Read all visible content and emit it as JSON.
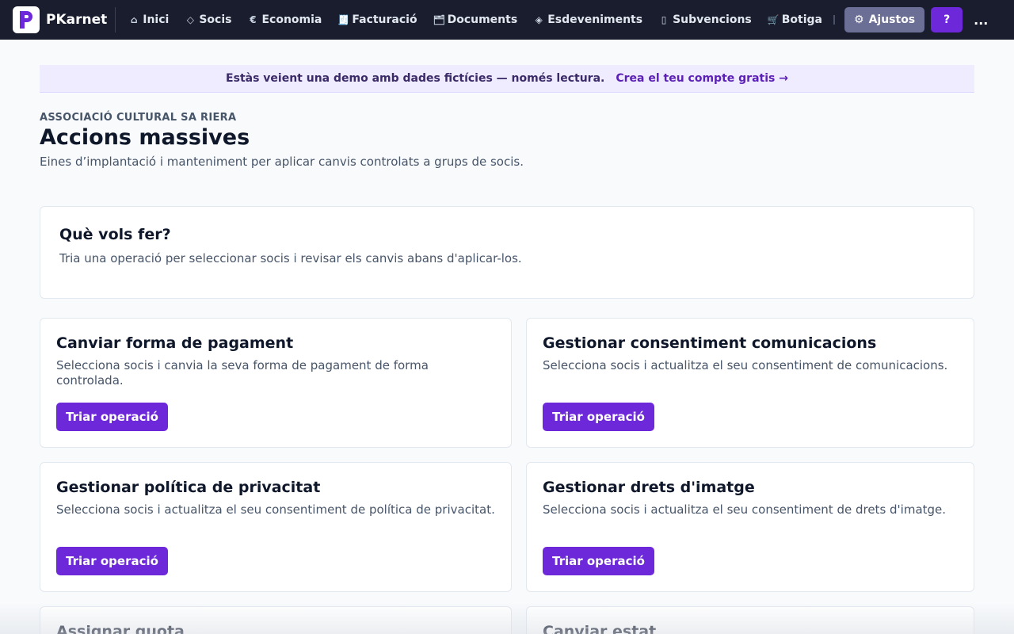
{
  "app": {
    "name": "PKarnet",
    "logo_letter": "P",
    "logo_color": "#6d28d9"
  },
  "nav": {
    "items": [
      {
        "label": "Inici",
        "icon": "home-icon",
        "glyph": "⌂"
      },
      {
        "label": "Socis",
        "icon": "diamond-icon",
        "glyph": "◇"
      },
      {
        "label": "Economia",
        "icon": "euro-icon",
        "glyph": "€"
      },
      {
        "label": "Facturació",
        "icon": "receipt-icon",
        "glyph": "🧾"
      },
      {
        "label": "Documents",
        "icon": "folder-icon",
        "glyph": "🗂"
      },
      {
        "label": "Esdeveniments",
        "icon": "diamond-dot-icon",
        "glyph": "◈"
      },
      {
        "label": "Subvencions",
        "icon": "columns-icon",
        "glyph": "▯"
      },
      {
        "label": "Botiga",
        "icon": "cart-icon",
        "glyph": "🛒"
      }
    ],
    "settings_label": "Ajustos",
    "settings_glyph": "⚙",
    "help_label": "?",
    "more_label": "..."
  },
  "banner": {
    "text": "Estàs veient una demo amb dades fictícies — només lectura.",
    "link": "Crea el teu compte gratis →"
  },
  "header": {
    "org": "ASSOCIACIÓ CULTURAL SA RIERA",
    "title": "Accions massives",
    "subtitle": "Eines d’implantació i manteniment per aplicar canvis controlats a grups de socis."
  },
  "intro": {
    "title": "Què vols fer?",
    "text": "Tria una operació per seleccionar socis i revisar els canvis abans d'aplicar-los."
  },
  "operations": [
    {
      "title": "Canviar forma de pagament",
      "description": "Selecciona socis i canvia la seva forma de pagament de forma controlada.",
      "button": "Triar operació"
    },
    {
      "title": "Gestionar consentiment comunicacions",
      "description": "Selecciona socis i actualitza el seu consentiment de comunicacions.",
      "button": "Triar operació"
    },
    {
      "title": "Gestionar política de privacitat",
      "description": "Selecciona socis i actualitza el seu consentiment de política de privacitat.",
      "button": "Triar operació"
    },
    {
      "title": "Gestionar drets d'imatge",
      "description": "Selecciona socis i actualitza el seu consentiment de drets d'imatge.",
      "button": "Triar operació"
    },
    {
      "title": "Assignar quota",
      "description": "",
      "button": ""
    },
    {
      "title": "Canviar estat",
      "description": "",
      "button": ""
    }
  ]
}
